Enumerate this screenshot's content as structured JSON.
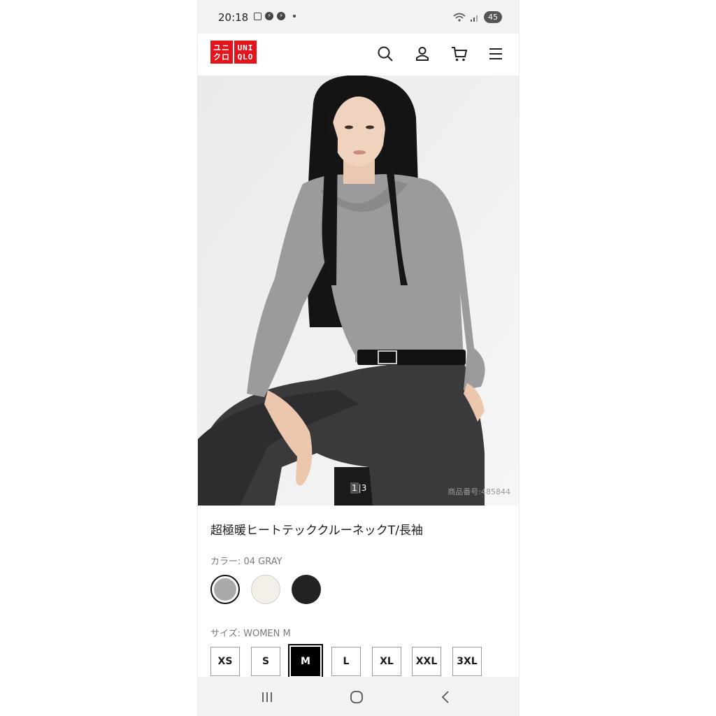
{
  "status_bar": {
    "time": "20:18",
    "battery": "45"
  },
  "header": {
    "logo_left": [
      "ユニ",
      "クロ"
    ],
    "logo_right": [
      "UNI",
      "QLO"
    ],
    "brand_color": "#e3141c",
    "icons": [
      "search-icon",
      "account-icon",
      "cart-icon",
      "menu-icon"
    ]
  },
  "hero": {
    "pager_current": "1",
    "pager_total": "3",
    "product_number": "商品番号:485844"
  },
  "product": {
    "title": "超極暖ヒートテッククルーネックT/長袖",
    "color_label": "カラー: 04 GRAY",
    "colors": [
      {
        "name": "GRAY",
        "hex": "#a9a9a9",
        "selected": true
      },
      {
        "name": "OFF WHITE",
        "hex": "#f3f0ea",
        "selected": false
      },
      {
        "name": "BLACK",
        "hex": "#222222",
        "selected": false
      }
    ],
    "size_label": "サイズ: WOMEN M",
    "sizes": [
      "XS",
      "S",
      "M",
      "L",
      "XL",
      "XXL",
      "3XL"
    ],
    "selected_size": "M"
  }
}
